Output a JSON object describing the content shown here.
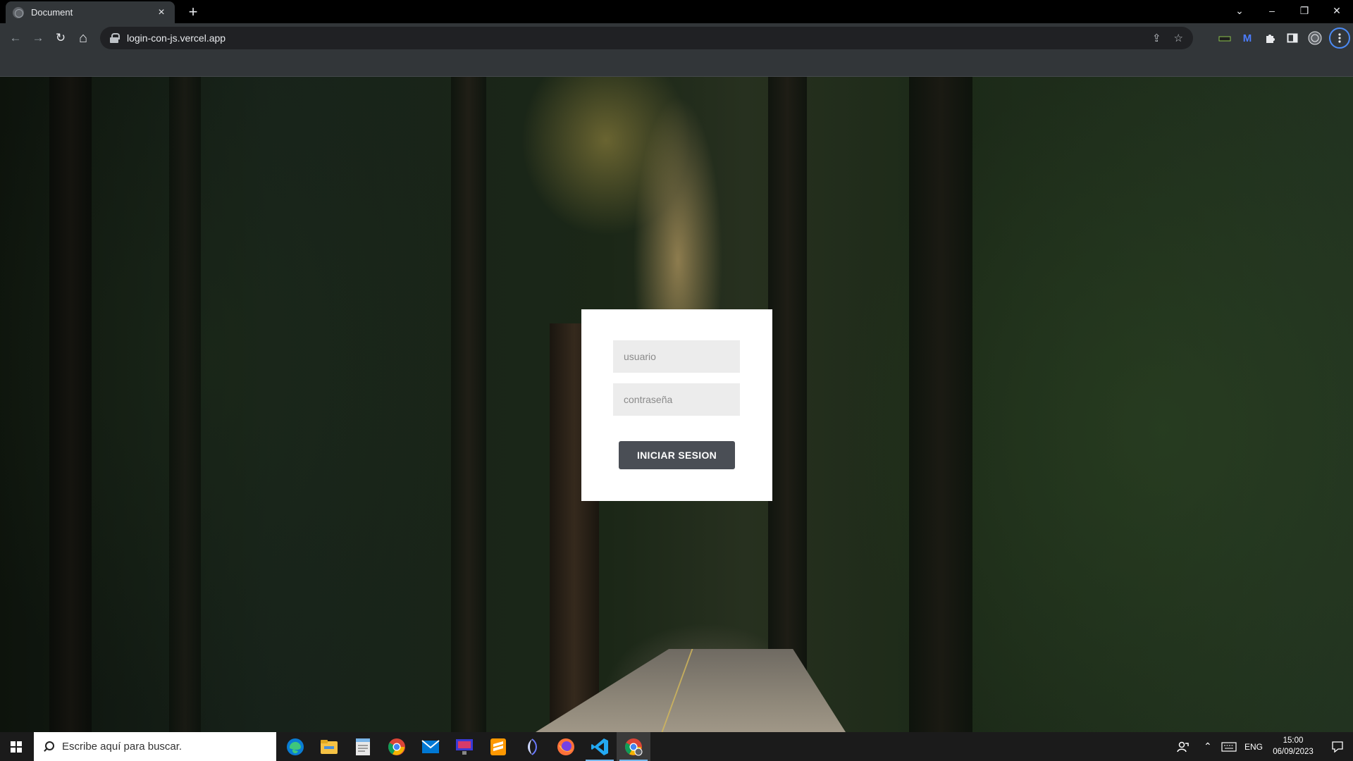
{
  "browser": {
    "tab_title": "Document",
    "tab_close": "×",
    "new_tab": "+",
    "url": "login-con-js.vercel.app",
    "window_controls": [
      "⌄",
      "–",
      "❐",
      "✕"
    ],
    "nav": {
      "back": "←",
      "forward": "→",
      "reload": "↻",
      "home": "⌂"
    },
    "omnibox_icons": [
      "share-icon",
      "star-icon"
    ],
    "extensions": [
      "extension-1-icon",
      "m-extension-icon",
      "puzzle-icon",
      "side-panel-icon",
      "profile-icon",
      "menu-icon"
    ]
  },
  "login": {
    "username_placeholder": "usuario",
    "password_placeholder": "contraseña",
    "submit_label": "INICIAR SESION"
  },
  "taskbar": {
    "search_placeholder": "Escribe aquí para buscar.",
    "apps": [
      "edge",
      "file-explorer",
      "notepad",
      "chrome",
      "mail",
      "monitor",
      "sublime",
      "clickup",
      "firefox",
      "vscode",
      "chrome-active"
    ],
    "language": "ENG",
    "time": "15:00",
    "date": "06/09/2023"
  },
  "colors": {
    "button_bg": "#4a4e55",
    "card_bg": "#ffffff",
    "input_bg": "#ececec"
  }
}
